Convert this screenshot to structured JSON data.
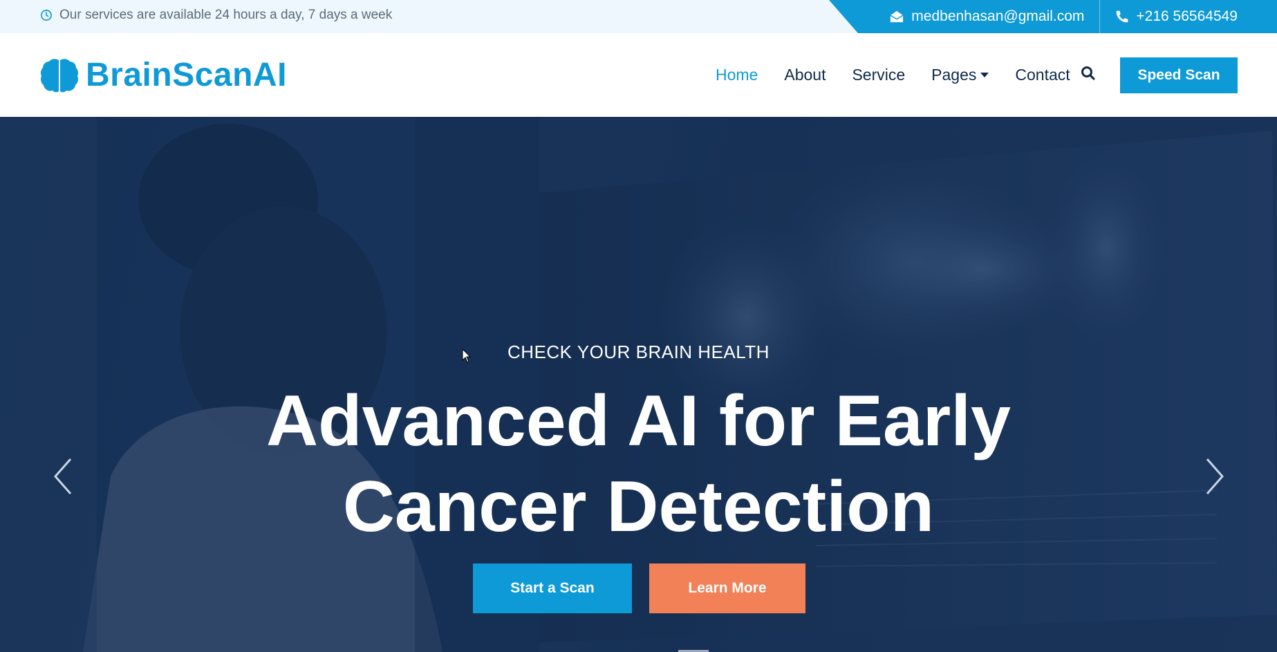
{
  "topbar": {
    "hours_text": "Our services are available 24 hours a day, 7 days a week",
    "email": "medbenhasan@gmail.com",
    "phone": "+216 56564549"
  },
  "brand": {
    "logo_text": "BrainScanAI",
    "accent_color": "#0e9ad7",
    "secondary_color": "#f28158"
  },
  "nav": {
    "items": [
      {
        "label": "Home",
        "active": true
      },
      {
        "label": "About"
      },
      {
        "label": "Service"
      },
      {
        "label": "Pages",
        "dropdown": true
      },
      {
        "label": "Contact"
      }
    ],
    "cta_label": "Speed Scan"
  },
  "hero": {
    "eyebrow": "CHECK YOUR BRAIN HEALTH",
    "headline_line1": "Advanced AI for Early",
    "headline_line2": "Cancer Detection",
    "primary_button": "Start a Scan",
    "secondary_button": "Learn More"
  },
  "icons": {
    "clock": "clock-icon",
    "email": "envelope-open-icon",
    "phone": "phone-icon",
    "logo": "brain-icon",
    "search": "search-icon",
    "prev": "chevron-left-icon",
    "next": "chevron-right-icon"
  }
}
